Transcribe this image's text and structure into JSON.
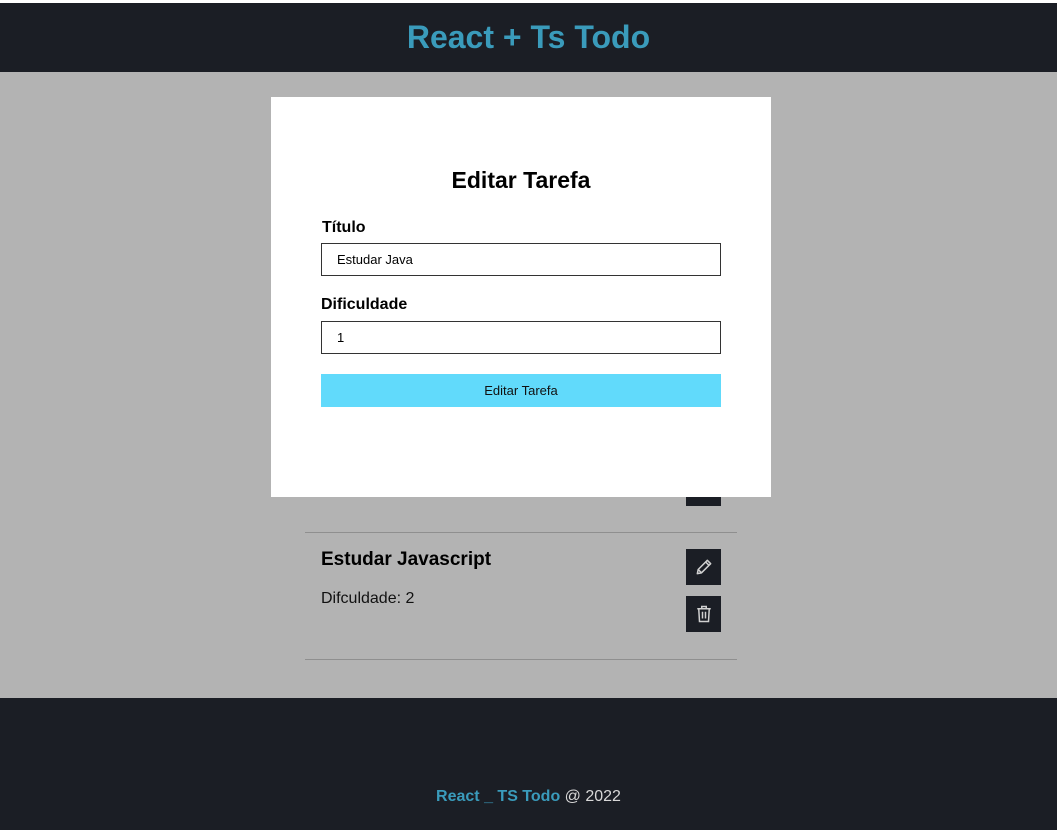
{
  "header": {
    "title": "React + Ts Todo"
  },
  "todo": {
    "title": "Estudar Javascript",
    "difficulty_text": "Difculdade: 2"
  },
  "modal": {
    "title": "Editar Tarefa",
    "title_field_label": "Título",
    "title_value": "Estudar Java",
    "difficulty_field_label": "Dificuldade",
    "difficulty_value": "1",
    "submit_label": "Editar Tarefa"
  },
  "footer": {
    "brand": "React _ TS Todo",
    "suffix": " @ 2022"
  },
  "colors": {
    "header_bg": "#1b1e25",
    "brand": "#3a9bbb",
    "overlay": "#b3b3b3",
    "button_accent": "#61dafb"
  },
  "icons": {
    "edit": "pencil-icon",
    "delete": "trash-icon"
  }
}
